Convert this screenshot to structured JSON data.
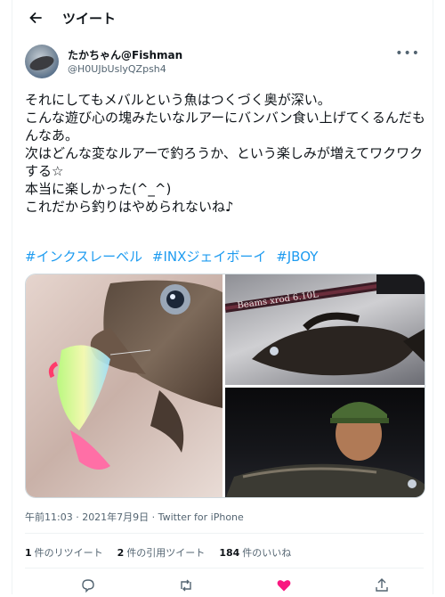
{
  "topbar": {
    "title": "ツイート"
  },
  "author": {
    "name": "たかちゃん@Fishman",
    "handle": "@H0UJbUslyQZpsh4"
  },
  "tweet": {
    "text": "それにしてもメバルという魚はつくづく奥が深い。\nこんな遊び心の塊みたいなルアーにバンバン食い上げてくるんだもんなあ。\n次はどんな変なルアーで釣ろうか、という楽しみが増えてワクワクする☆\n本当に楽しかった(^_^)\nこれだから釣りはやめられないね♪",
    "hashtags": [
      "#インクスレーベル",
      "#INXジェイボーイ",
      "#JBOY"
    ]
  },
  "media": {
    "rod_text": "Beams xrod 6.10L"
  },
  "meta": {
    "timestamp": "午前11:03 · 2021年7月9日 · Twitter for iPhone"
  },
  "stats": [
    {
      "count": "1",
      "label": "件のリツイート"
    },
    {
      "count": "2",
      "label": "件の引用ツイート"
    },
    {
      "count": "184",
      "label": "件のいいね"
    }
  ],
  "colors": {
    "accent": "#1d9bf0",
    "like": "#f91880",
    "secondary_text": "#536471"
  },
  "icons": [
    "back-arrow-icon",
    "more-icon",
    "reply-icon",
    "retweet-icon",
    "like-icon",
    "share-icon"
  ]
}
